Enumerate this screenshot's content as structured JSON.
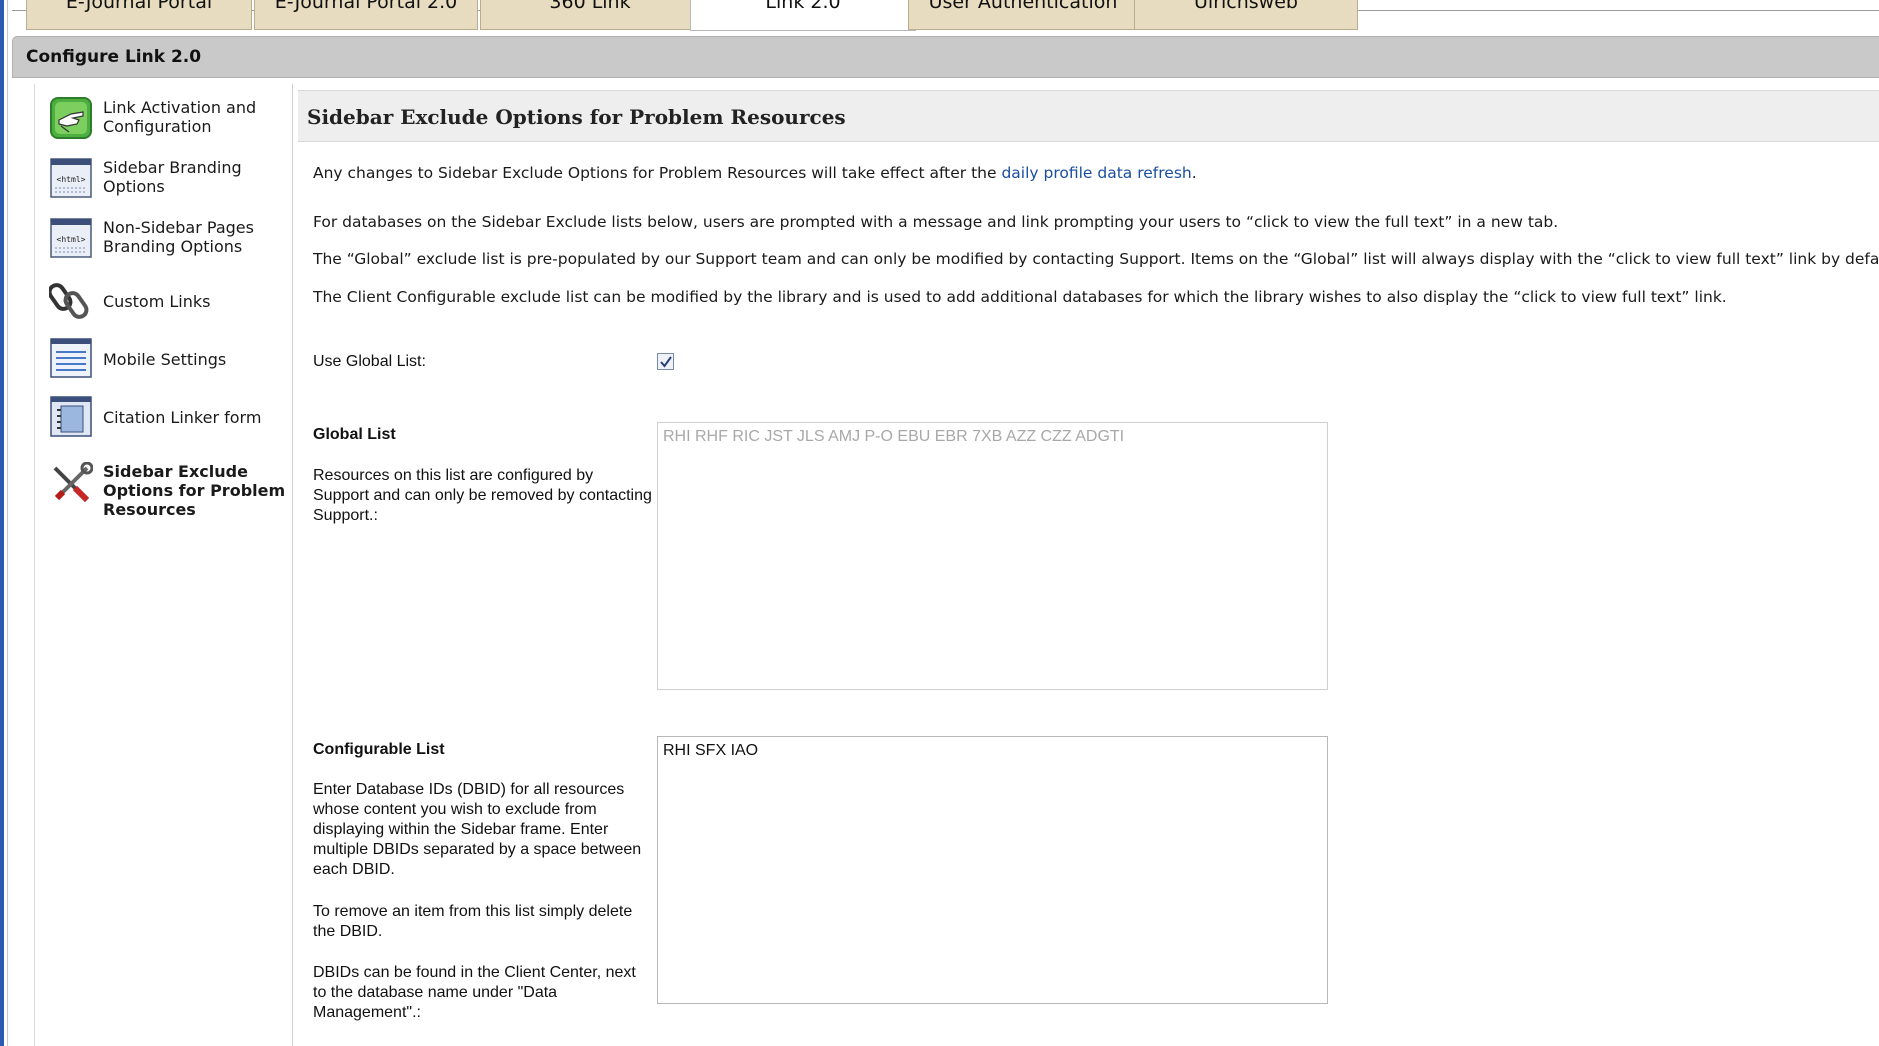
{
  "tabs": [
    {
      "label": "E-Journal Portal",
      "active": false
    },
    {
      "label": "E-Journal Portal 2.0",
      "active": false
    },
    {
      "label": "360 Link",
      "active": false
    },
    {
      "label": "Link 2.0",
      "active": true
    },
    {
      "label": "User Authentication",
      "active": false
    },
    {
      "label": "Ulrichsweb",
      "active": false
    }
  ],
  "header": {
    "title": "Configure Link 2.0"
  },
  "sidebar": {
    "items": [
      {
        "label": "Link Activation and Configuration",
        "icon": "hand-pointer-icon"
      },
      {
        "label": "Sidebar Branding Options",
        "icon": "html-window-icon"
      },
      {
        "label": "Non-Sidebar Pages Branding Options",
        "icon": "html-window-icon"
      },
      {
        "label": "Custom Links",
        "icon": "chain-link-icon"
      },
      {
        "label": "Mobile Settings",
        "icon": "mobile-window-icon"
      },
      {
        "label": "Citation Linker form",
        "icon": "notebook-icon"
      },
      {
        "label": "Sidebar Exclude Options for Problem Resources",
        "icon": "tools-icon",
        "active": true
      }
    ]
  },
  "main": {
    "section_title": "Sidebar Exclude Options for Problem Resources",
    "intro_prefix": "Any changes to Sidebar Exclude Options for Problem Resources will take effect after the ",
    "intro_link": "daily profile data refresh",
    "intro_suffix": ".",
    "para1": "For databases on the Sidebar Exclude lists below, users are prompted with a message and link prompting your users to “click to view the full text” in a new tab.",
    "para2": "The “Global” exclude list is pre-populated by our Support team and can only be modified by contacting Support. Items on the “Global” list will always display with the “click to view full text” link by default.",
    "para3": "The Client Configurable exclude list can be modified by the library and is used to add additional databases for which the library wishes to also display the “click to view full text” link.",
    "use_global_label": "Use Global List:",
    "use_global_checked": true,
    "global_list": {
      "label": "Global List",
      "description": "Resources on this list are configured by Support and can only be removed by contacting Support.:",
      "value": "RHI RHF RIC JST JLS AMJ P-O EBU EBR 7XB AZZ CZZ ADGTI"
    },
    "configurable_list": {
      "label": "Configurable List",
      "description1": "Enter Database IDs (DBID) for all resources whose content you wish to exclude from displaying within the Sidebar frame. Enter multiple DBIDs separated by a space between each DBID.",
      "description2": "To remove an item from this list simply delete the DBID.",
      "description3": "DBIDs can be found in the Client Center, next to the database name under \"Data Management\".:",
      "value": "RHI SFX IAO"
    }
  }
}
